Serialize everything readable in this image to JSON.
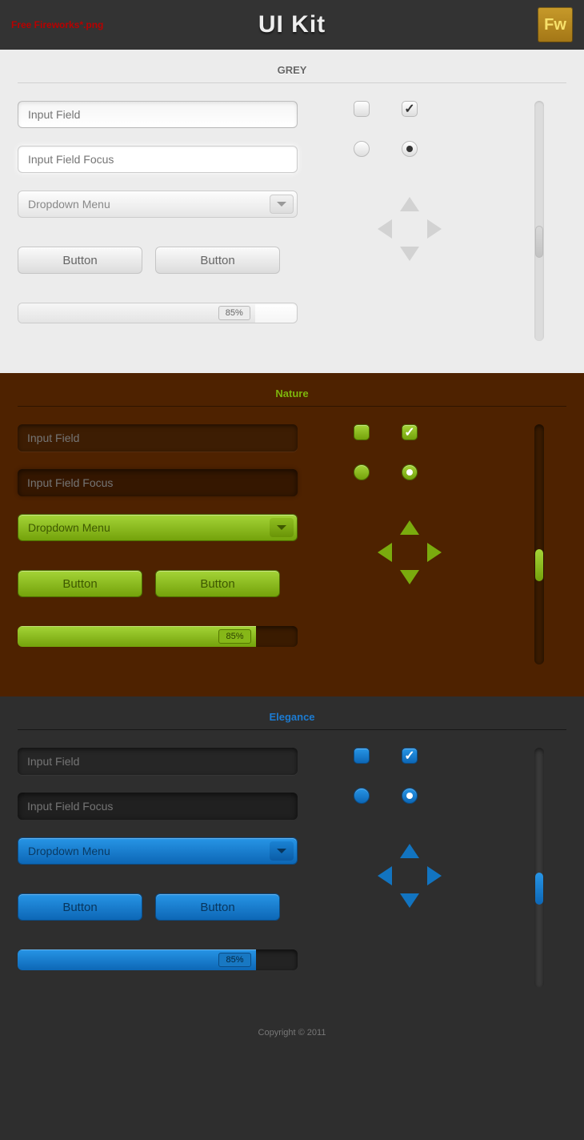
{
  "header": {
    "left": "Free Fireworks*.png",
    "title": "UI Kit",
    "logo": "Fw"
  },
  "themes": [
    {
      "key": "grey",
      "title": "GREY",
      "class": "t-grey"
    },
    {
      "key": "nature",
      "title": "Nature",
      "class": "t-nature"
    },
    {
      "key": "elegance",
      "title": "Elegance",
      "class": "t-elegance"
    }
  ],
  "controls": {
    "input_placeholder": "Input Field",
    "input_focus_placeholder": "Input Field Focus",
    "dropdown_label": "Dropdown Menu",
    "button_label": "Button",
    "progress_value": 85,
    "progress_label": "85%"
  },
  "checkboxes": {
    "state1": false,
    "state2": true
  },
  "radios": {
    "state1": false,
    "state2": true
  },
  "footer": "Copyright © 2011"
}
